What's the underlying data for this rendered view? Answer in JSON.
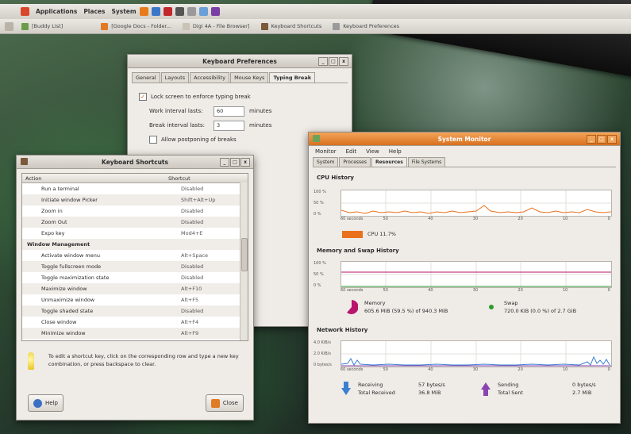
{
  "colors": {
    "accent": "#e07a24",
    "cpu": "#e9711c",
    "memory": "#b9156d",
    "swap": "#2f9a2f",
    "receiving": "#3b7fd1",
    "sending": "#8a44b2"
  },
  "top_panel": {
    "menus": [
      "Applications",
      "Places",
      "System"
    ]
  },
  "taskbar": {
    "items": [
      "[Buddy List]",
      "[Google Docs - Folder...",
      "Digi 4A - File Browser]",
      "Keyboard Shortcuts",
      "Keyboard Preferences"
    ]
  },
  "kb_prefs": {
    "title": "Keyboard Preferences",
    "tabs": [
      "General",
      "Layouts",
      "Accessibility",
      "Mouse Keys",
      "Typing Break"
    ],
    "lock_label": "Lock screen to enforce typing break",
    "work_label": "Work interval lasts:",
    "work_value": "60",
    "break_label": "Break interval lasts:",
    "break_value": "3",
    "minutes": "minutes",
    "postpone_label": "Allow postponing of breaks"
  },
  "kb_short": {
    "title": "Keyboard Shortcuts",
    "col_action": "Action",
    "col_shortcut": "Shortcut",
    "rows": [
      {
        "action": "Run a terminal",
        "shortcut": "Disabled"
      },
      {
        "action": "Initiate window Picker",
        "shortcut": "Shift+Alt+Up"
      },
      {
        "action": "Zoom in",
        "shortcut": "Disabled"
      },
      {
        "action": "Zoom Out",
        "shortcut": "Disabled"
      },
      {
        "action": "Expo key",
        "shortcut": "Mod4+E"
      },
      {
        "action": "Window Management",
        "shortcut": ""
      },
      {
        "action": "Activate window menu",
        "shortcut": "Alt+Space"
      },
      {
        "action": "Toggle fullscreen mode",
        "shortcut": "Disabled"
      },
      {
        "action": "Toggle maximization state",
        "shortcut": "Disabled"
      },
      {
        "action": "Maximize window",
        "shortcut": "Alt+F10"
      },
      {
        "action": "Unmaximize window",
        "shortcut": "Alt+F5"
      },
      {
        "action": "Toggle shaded state",
        "shortcut": "Disabled"
      },
      {
        "action": "Close window",
        "shortcut": "Alt+F4"
      },
      {
        "action": "Minimize window",
        "shortcut": "Alt+F9"
      }
    ],
    "hint": "To edit a shortcut key, click on the corresponding row and type a new key combination, or press backspace to clear.",
    "help_label": "Help",
    "close_label": "Close"
  },
  "sys_mon": {
    "title": "System Monitor",
    "menus": [
      "Monitor",
      "Edit",
      "View",
      "Help"
    ],
    "tabs": [
      "System",
      "Processes",
      "Resources",
      "File Systems"
    ],
    "cpu_title": "CPU History",
    "mem_title": "Memory and Swap History",
    "net_title": "Network History",
    "pct_ticks": [
      "100 %",
      "50 %",
      "0 %"
    ],
    "net_ticks": [
      "4.0 KiB/s",
      "2.0 KiB/s",
      "0 bytes/s"
    ],
    "x_ticks": [
      "60 seconds",
      "50",
      "40",
      "30",
      "20",
      "10",
      "0"
    ],
    "cpu_legend": "CPU 11.7%",
    "memory_label": "Memory",
    "memory_value": "605.6 MiB (59.5 %) of 940.3 MiB",
    "swap_label": "Swap",
    "swap_value": "720.0 KiB (0.0 %) of 2.7 GiB",
    "receiving_label": "Receiving",
    "receiving_rate": "57 bytes/s",
    "total_received_label": "Total Received",
    "total_received": "36.8 MiB",
    "sending_label": "Sending",
    "sending_rate": "0 bytes/s",
    "total_sent_label": "Total Sent",
    "total_sent": "2.7 MiB"
  }
}
